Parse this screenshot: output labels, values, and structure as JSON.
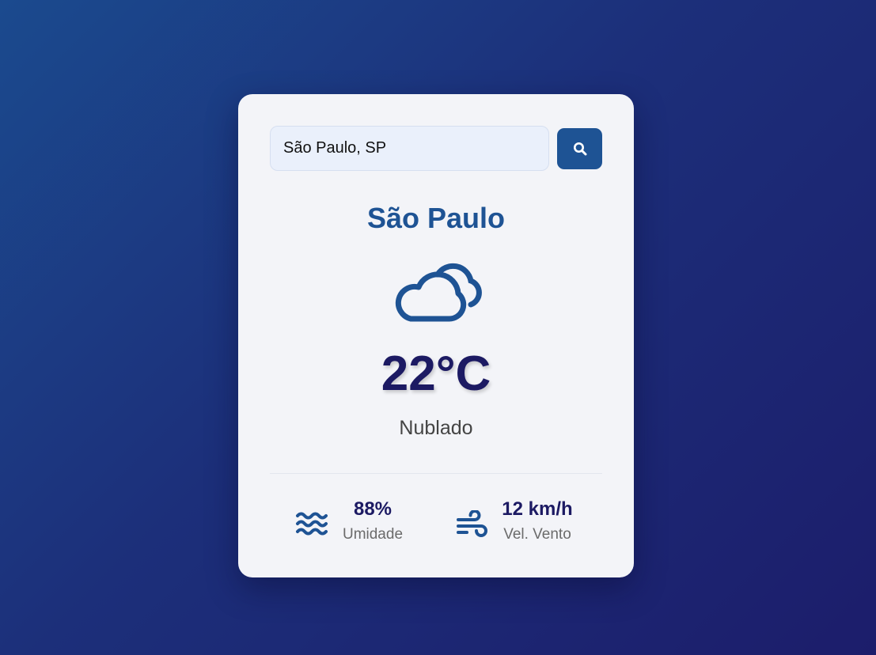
{
  "search": {
    "value": "São Paulo, SP",
    "button_icon": "search-icon"
  },
  "weather": {
    "city": "São Paulo",
    "icon": "cloud-icon",
    "temperature": "22°C",
    "description": "Nublado"
  },
  "stats": {
    "humidity": {
      "icon": "water-waves-icon",
      "value": "88%",
      "label": "Umidade"
    },
    "wind": {
      "icon": "wind-icon",
      "value": "12 km/h",
      "label": "Vel. Vento"
    }
  },
  "colors": {
    "accent": "#1e5394",
    "temperature": "#1c1a63",
    "card": "#f3f4f8"
  }
}
